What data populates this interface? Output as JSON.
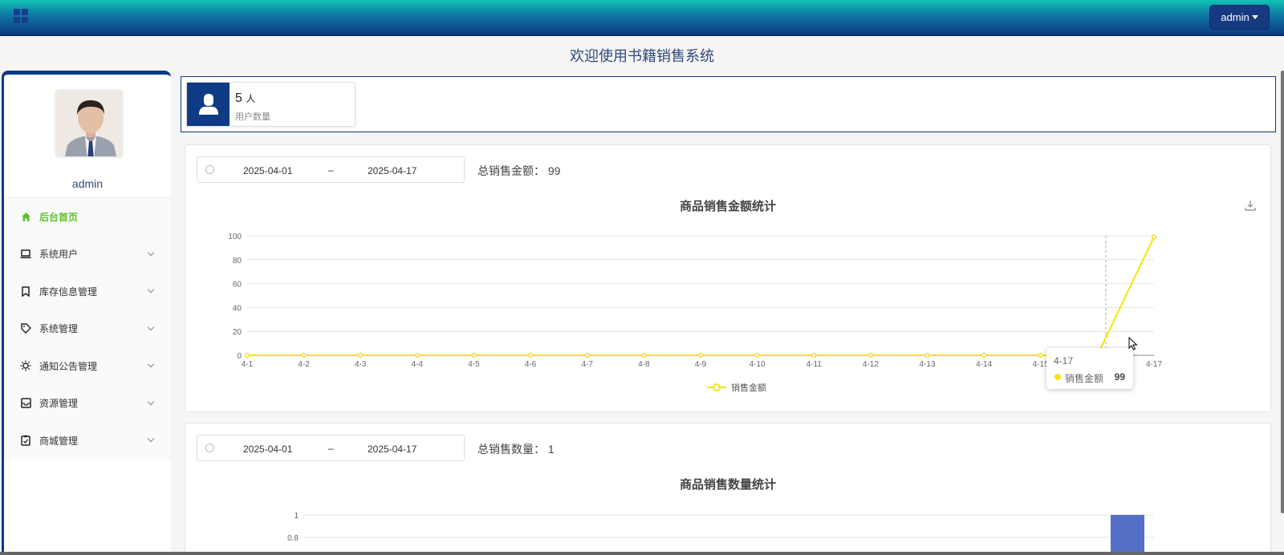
{
  "header": {
    "user_label": "admin"
  },
  "welcome": "欢迎使用书籍销售系统",
  "sidebar": {
    "username": "admin",
    "items": [
      {
        "label": "后台首页",
        "icon": "home-icon",
        "active": true
      },
      {
        "label": "系统用户",
        "icon": "laptop-icon"
      },
      {
        "label": "库存信息管理",
        "icon": "bookmark-icon"
      },
      {
        "label": "系统管理",
        "icon": "tag-icon"
      },
      {
        "label": "通知公告管理",
        "icon": "sun-icon"
      },
      {
        "label": "资源管理",
        "icon": "inbox-icon"
      },
      {
        "label": "商城管理",
        "icon": "clipboard-icon"
      }
    ]
  },
  "stat": {
    "value": "5",
    "unit": "人",
    "label": "用户数量"
  },
  "panel1": {
    "start": "2025-04-01",
    "sep": "–",
    "end": "2025-04-17",
    "total_label": "总销售金额：",
    "total_value": "99",
    "title": "商品销售金额统计"
  },
  "panel2": {
    "start": "2025-04-01",
    "sep": "–",
    "end": "2025-04-17",
    "total_label": "总销售数量：",
    "total_value": "1",
    "title": "商品销售数量统计"
  },
  "tooltip": {
    "x": "4-17",
    "name": "销售金额",
    "value": "99"
  },
  "colors": {
    "primary": "#0f3a84",
    "line": "#f5e50a",
    "bar": "#5470c6",
    "active_menu": "#5fc12f"
  },
  "chart_data": [
    {
      "type": "line",
      "title": "商品销售金额统计",
      "categories": [
        "4-1",
        "4-2",
        "4-3",
        "4-4",
        "4-5",
        "4-6",
        "4-7",
        "4-8",
        "4-9",
        "4-10",
        "4-11",
        "4-12",
        "4-13",
        "4-14",
        "4-15",
        "4-16",
        "4-17"
      ],
      "series": [
        {
          "name": "销售金额",
          "values": [
            0,
            0,
            0,
            0,
            0,
            0,
            0,
            0,
            0,
            0,
            0,
            0,
            0,
            0,
            0,
            0,
            99
          ]
        }
      ],
      "yticks": [
        "0",
        "20",
        "40",
        "60",
        "80",
        "100"
      ],
      "ylim": [
        0,
        100
      ],
      "legend": "bottom-center",
      "grid": true
    },
    {
      "type": "bar",
      "title": "商品销售数量统计",
      "yticks_visible": [
        "1",
        "0.8"
      ],
      "ylim": [
        0,
        1
      ],
      "visible_bar_value": 1
    }
  ]
}
